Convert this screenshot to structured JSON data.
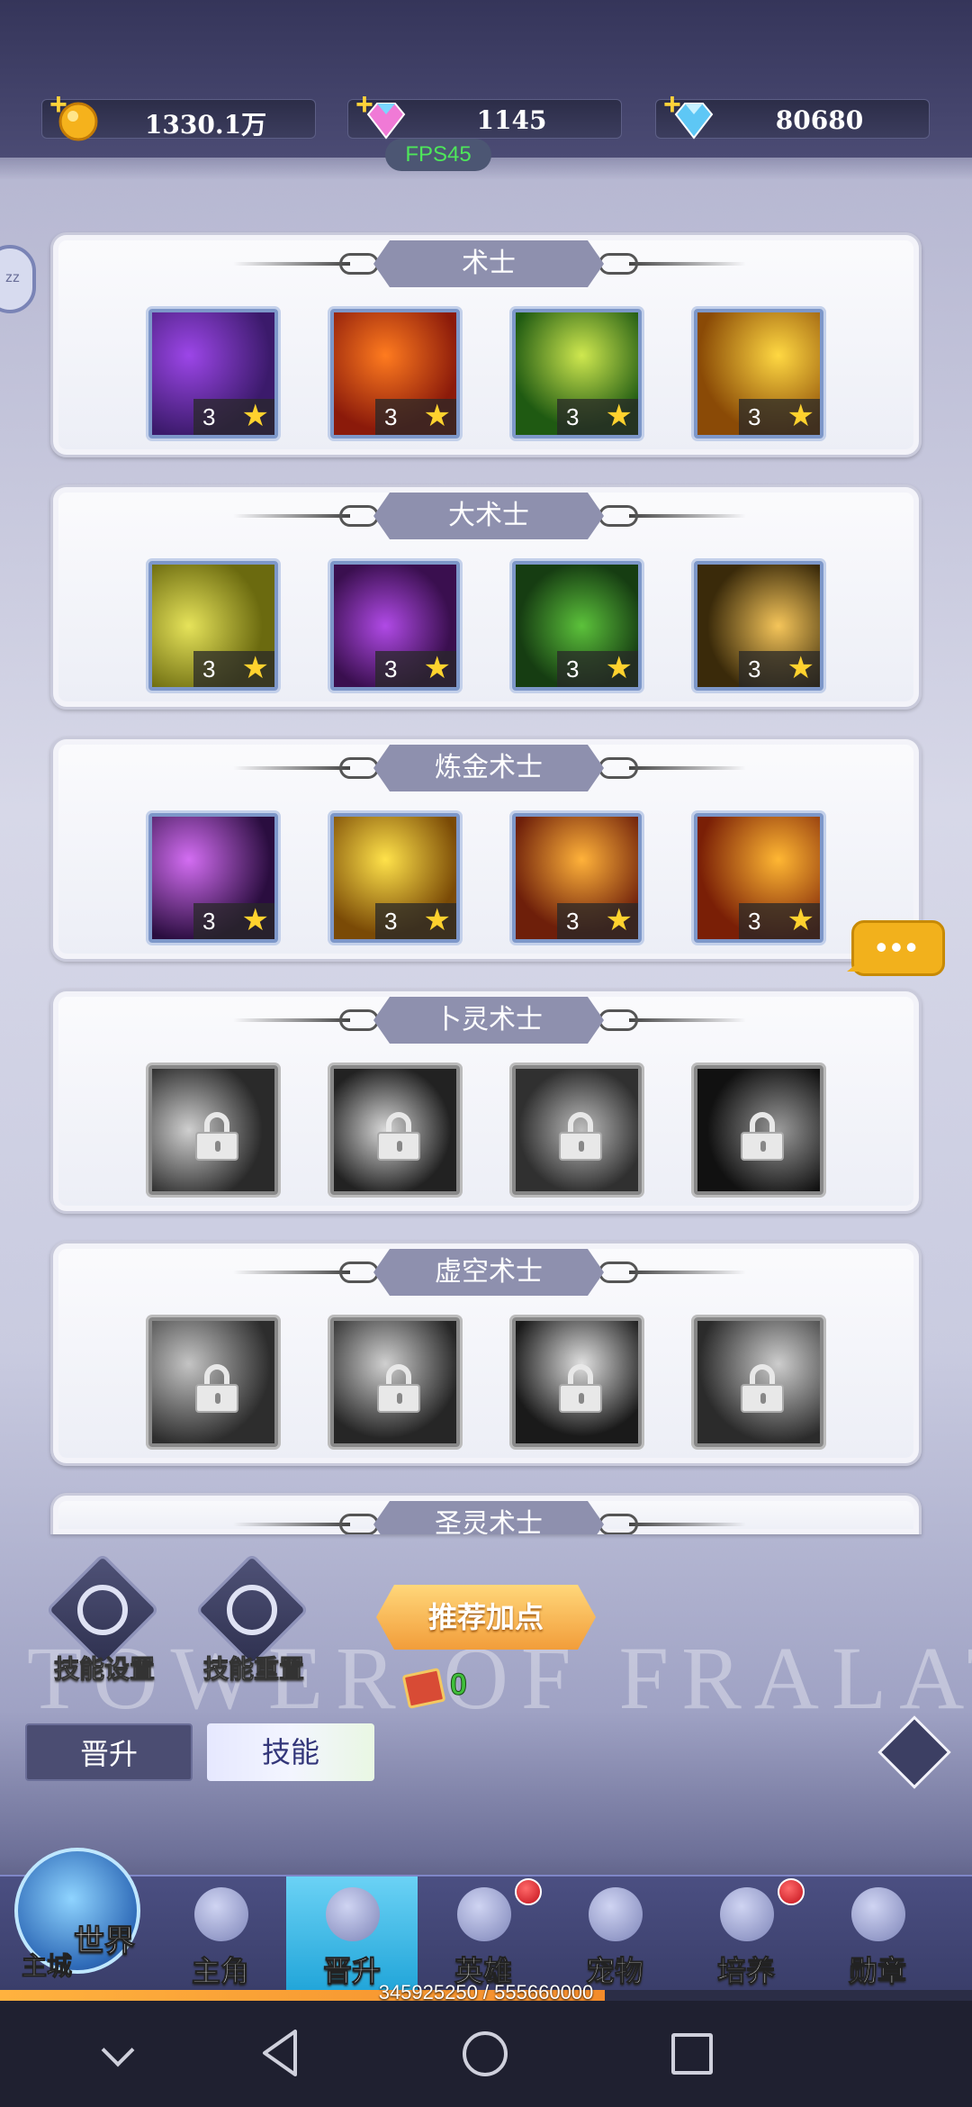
{
  "resources": {
    "gold": "1330.1万",
    "diamond_pink": "1145",
    "diamond_blue": "80680",
    "fps": "FPS45"
  },
  "classes": [
    {
      "name": "术士",
      "skills": [
        {
          "icon": "purple-orb-skill-icon",
          "level": "3",
          "locked": false,
          "colors": [
            "#3b1a6b",
            "#9c46e8"
          ]
        },
        {
          "icon": "fire-burst-skill-icon",
          "level": "3",
          "locked": false,
          "colors": [
            "#8b1a0a",
            "#ff7b1f"
          ]
        },
        {
          "icon": "green-light-skill-icon",
          "level": "3",
          "locked": false,
          "colors": [
            "#1f5a12",
            "#cfe84f"
          ]
        },
        {
          "icon": "golden-shield-skill-icon",
          "level": "3",
          "locked": false,
          "colors": [
            "#8a4a06",
            "#ffd842"
          ]
        }
      ]
    },
    {
      "name": "大术士",
      "skills": [
        {
          "icon": "yellow-vortex-skill-icon",
          "level": "3",
          "locked": false,
          "colors": [
            "#6b6a0f",
            "#e6e35a"
          ]
        },
        {
          "icon": "shadow-figure-skill-icon",
          "level": "3",
          "locked": false,
          "colors": [
            "#3a0f4f",
            "#b04ae6"
          ]
        },
        {
          "icon": "green-imp-skill-icon",
          "level": "3",
          "locked": false,
          "colors": [
            "#163d12",
            "#5cc23b"
          ]
        },
        {
          "icon": "angel-wings-skill-icon",
          "level": "3",
          "locked": false,
          "colors": [
            "#3a2a0a",
            "#f5c55a"
          ]
        }
      ]
    },
    {
      "name": "炼金术士",
      "skills": [
        {
          "icon": "purple-slash-skill-icon",
          "level": "3",
          "locked": false,
          "colors": [
            "#2a0d3f",
            "#d36df2"
          ]
        },
        {
          "icon": "golden-feathers-skill-icon",
          "level": "3",
          "locked": false,
          "colors": [
            "#7a4a06",
            "#ffe24a"
          ]
        },
        {
          "icon": "alchemy-burst-skill-icon",
          "level": "3",
          "locked": false,
          "colors": [
            "#6e1f0a",
            "#ffb23a"
          ]
        },
        {
          "icon": "flame-shield-skill-icon",
          "level": "3",
          "locked": false,
          "colors": [
            "#7a1f06",
            "#ffb733"
          ]
        }
      ]
    },
    {
      "name": "卜灵术士",
      "skills": [
        {
          "icon": "summon-circle-skill-icon",
          "level": "",
          "locked": true,
          "colors": [
            "#2a2a2a",
            "#cfcfcf"
          ]
        },
        {
          "icon": "swirl-skill-icon",
          "level": "",
          "locked": true,
          "colors": [
            "#222",
            "#d8d8d8"
          ]
        },
        {
          "icon": "crack-burst-skill-icon",
          "level": "",
          "locked": true,
          "colors": [
            "#303030",
            "#bdbdbd"
          ]
        },
        {
          "icon": "dark-wing-skill-icon",
          "level": "",
          "locked": true,
          "colors": [
            "#111",
            "#9a9a9a"
          ]
        }
      ]
    },
    {
      "name": "虚空术士",
      "skills": [
        {
          "icon": "void-rune-skill-icon",
          "level": "",
          "locked": true,
          "colors": [
            "#2d2d2d",
            "#c4c4c4"
          ]
        },
        {
          "icon": "void-vortex-skill-icon",
          "level": "",
          "locked": true,
          "colors": [
            "#262626",
            "#d0d0d0"
          ]
        },
        {
          "icon": "void-slash-skill-icon",
          "level": "",
          "locked": true,
          "colors": [
            "#1a1a1a",
            "#e0e0e0"
          ]
        },
        {
          "icon": "galaxy-skill-icon",
          "level": "",
          "locked": true,
          "colors": [
            "#2b2b2b",
            "#cdcdcd"
          ]
        }
      ]
    },
    {
      "name": "圣灵术士",
      "skills": []
    }
  ],
  "tools": {
    "skill_settings": "技能设置",
    "skill_reset": "技能重置",
    "recommend": "推荐加点",
    "points": "0",
    "watermark": "TOWER OF FRALAT"
  },
  "tabs": {
    "promote": "晋升",
    "skills": "技能"
  },
  "nav": {
    "world": "世界",
    "main_city": "主城",
    "items": [
      {
        "label": "主角",
        "badge": false,
        "active": false
      },
      {
        "label": "晋升",
        "badge": false,
        "active": true
      },
      {
        "label": "英雄",
        "badge": true,
        "active": false
      },
      {
        "label": "宠物",
        "badge": false,
        "active": false
      },
      {
        "label": "培养",
        "badge": true,
        "active": false
      },
      {
        "label": "勋章",
        "badge": false,
        "active": false
      }
    ]
  },
  "exp": {
    "text": "345925250 / 555660000",
    "fraction": 0.6226
  }
}
